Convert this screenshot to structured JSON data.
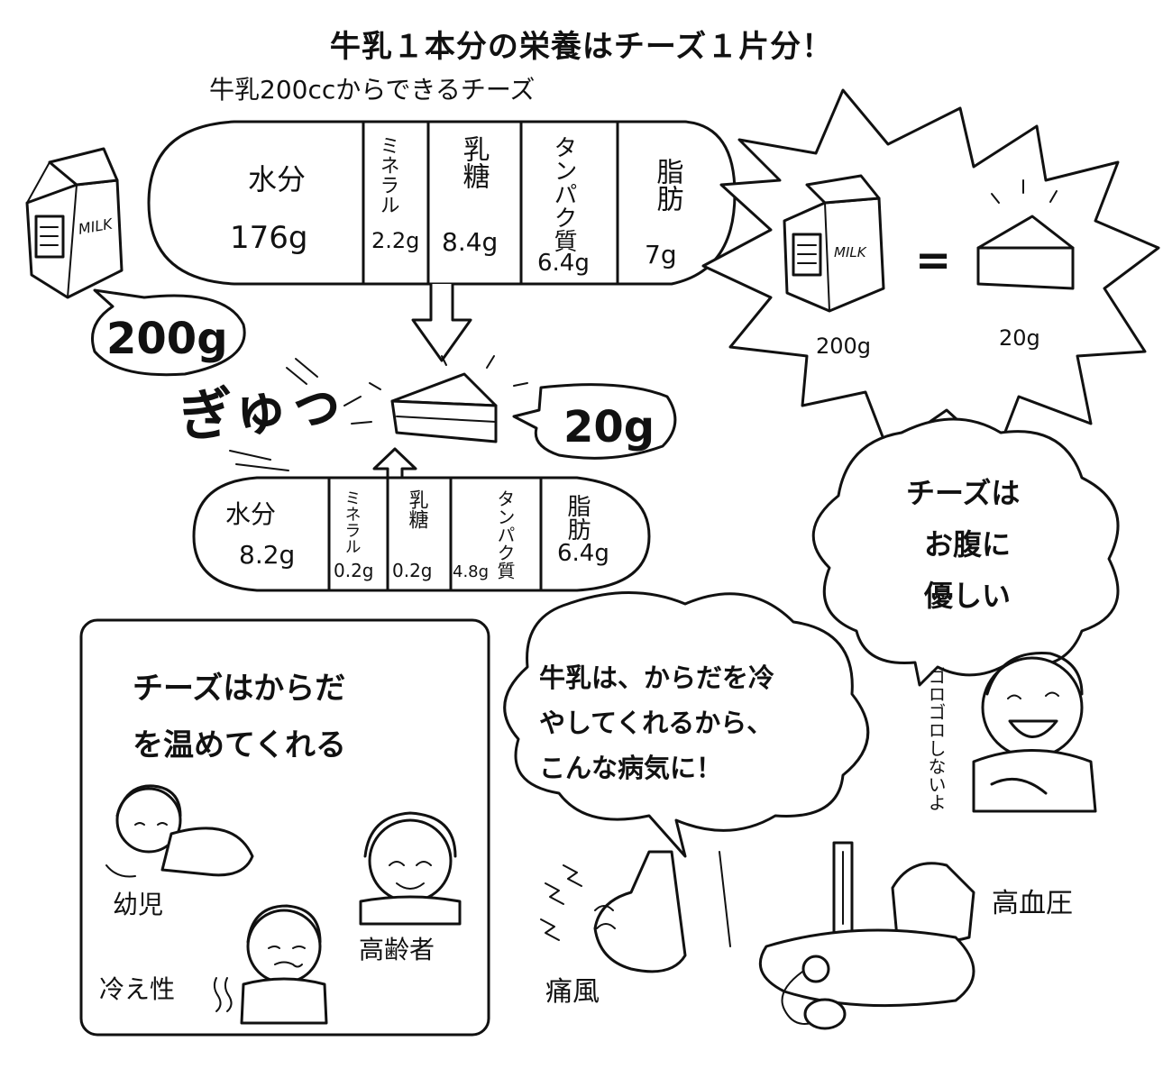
{
  "title": "牛乳１本分の栄養はチーズ１片分！",
  "subtitle": "牛乳200ccからできるチーズ",
  "milk_nutrition": [
    {
      "label": "水分",
      "value": "176g"
    },
    {
      "label": "ミネラル",
      "value": "2.2g"
    },
    {
      "label": "乳糖",
      "value": "8.4g"
    },
    {
      "label": "タンパク質",
      "value": "6.4g"
    },
    {
      "label": "脂肪",
      "value": "7g"
    }
  ],
  "cheese_nutrition": [
    {
      "label": "水分",
      "value": "8.2g"
    },
    {
      "label": "ミネラル",
      "value": "0.2g"
    },
    {
      "label": "乳糖",
      "value": "0.2g"
    },
    {
      "label": "タンパク質",
      "value": "4.8g"
    },
    {
      "label": "脂肪",
      "value": "6.4g"
    }
  ],
  "milk_weight_bubble": "200g",
  "cheese_weight_bubble": "20g",
  "sound_effect": "ぎゅっ",
  "milk_label": "MILK",
  "comparison": {
    "left": "200g",
    "equals": "=",
    "right": "20g"
  },
  "warm_box": {
    "line1": "チーズはからだ",
    "line2": "を温めてくれる"
  },
  "people": {
    "infant": "幼児",
    "elderly": "高齢者",
    "cold": "冷え性"
  },
  "cloud_milk": {
    "line1": "牛乳は、からだを冷",
    "line2": "やしてくれるから、",
    "line3": "こんな病気に！"
  },
  "cloud_stomach": {
    "line1": "チーズは",
    "line2": "お腹に",
    "line3": "優しい"
  },
  "goro": "ゴロゴロしないよ",
  "diseases": {
    "gout": "痛風",
    "hypertension": "高血圧"
  }
}
